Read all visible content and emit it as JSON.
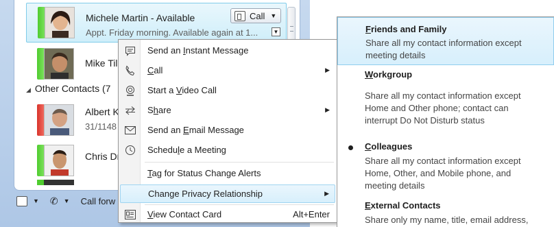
{
  "contacts": [
    {
      "name": "Michele Martin - Available",
      "status": "Appt. Friday morning. Available again at 1..."
    },
    {
      "name": "Mike Till"
    },
    {
      "name": "Albert K",
      "status": "31/1148"
    },
    {
      "name": "Chris Dra"
    }
  ],
  "call_button": {
    "label": "Call"
  },
  "group": {
    "label": "Other Contacts (7"
  },
  "bottom_bar": {
    "call_forward": "Call forw"
  },
  "menu": {
    "items": [
      {
        "pre": "Send an ",
        "u": "I",
        "post": "nstant Message"
      },
      {
        "pre": "",
        "u": "C",
        "post": "all"
      },
      {
        "pre": "Start a ",
        "u": "V",
        "post": "ideo Call"
      },
      {
        "pre": "S",
        "u": "h",
        "post": "are"
      },
      {
        "pre": "Send an ",
        "u": "E",
        "post": "mail Message"
      },
      {
        "pre": "Schedu",
        "u": "l",
        "post": "e a Meeting"
      },
      {
        "pre": "",
        "u": "T",
        "post": "ag for Status Change Alerts"
      },
      {
        "pre": "Chan",
        "u": "g",
        "post": "e Privacy Relationship"
      },
      {
        "pre": "",
        "u": "V",
        "post": "iew Contact Card",
        "shortcut": "Alt+Enter"
      }
    ]
  },
  "submenu": {
    "items": [
      {
        "pre": "",
        "u": "F",
        "post": "riends and Family",
        "desc": "Share all my contact information except meeting details"
      },
      {
        "pre": "",
        "u": "W",
        "post": "orkgroup",
        "desc": "Share all my contact information except Home and Other phone; contact can interrupt Do Not Disturb status"
      },
      {
        "pre": "",
        "u": "C",
        "post": "olleagues",
        "desc": "Share all my contact information except Home, Other, and Mobile phone, and meeting details"
      },
      {
        "pre": "",
        "u": "E",
        "post": "xternal Contacts",
        "desc": "Share only my name, title, email address,"
      }
    ]
  },
  "colors": {
    "accent": "#7fcbe9",
    "available": "#4fcc2f",
    "busy": "#d9332b"
  }
}
